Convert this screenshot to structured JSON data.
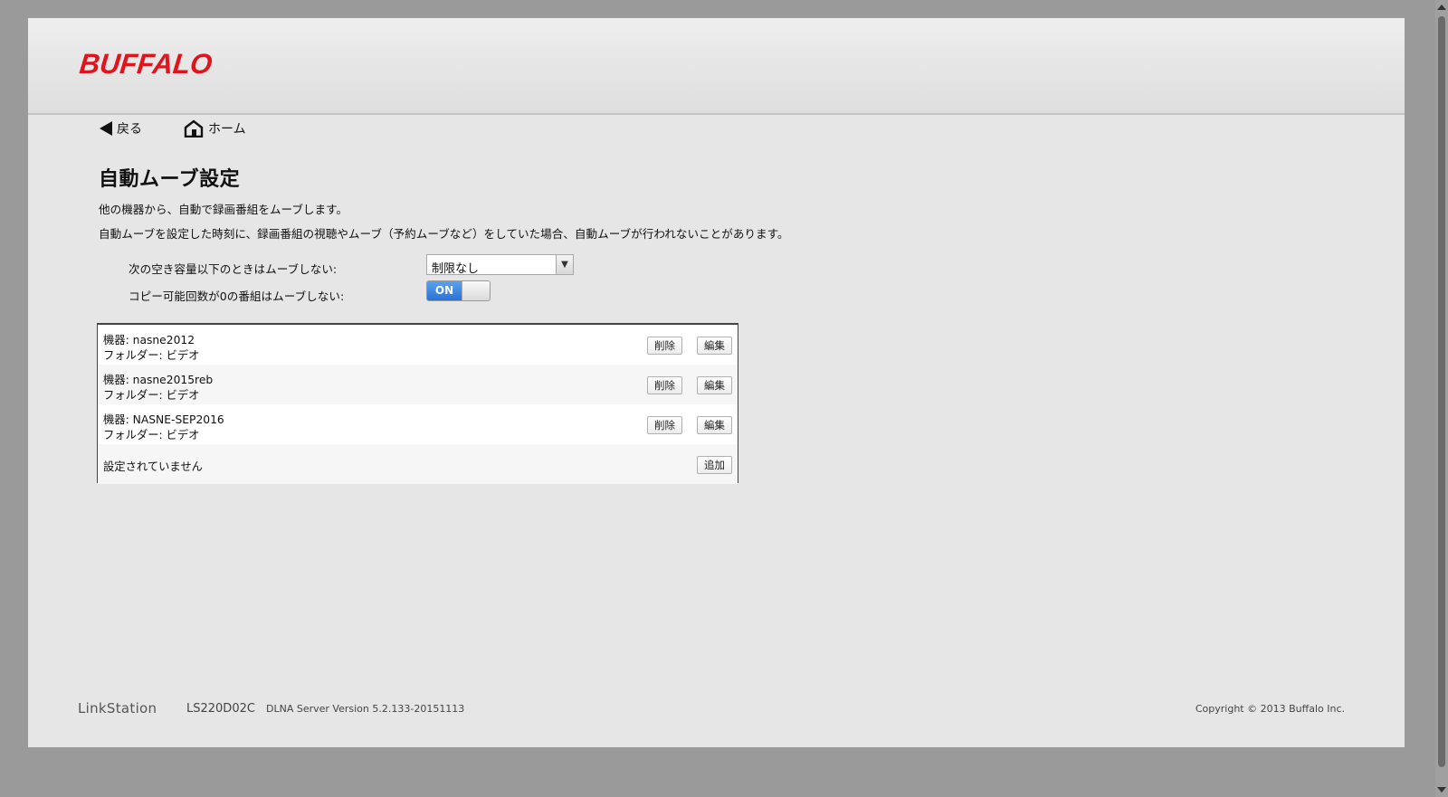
{
  "header": {
    "logo": "BUFFALO"
  },
  "nav": {
    "back_label": "戻る",
    "home_label": "ホーム"
  },
  "main": {
    "title": "自動ムーブ設定",
    "desc1": "他の機器から、自動で録画番組をムーブします。",
    "desc2": "自動ムーブを設定した時刻に、録画番組の視聴やムーブ（予約ムーブなど）をしていた場合、自動ムーブが行われないことがあります。"
  },
  "settings": {
    "capacity_label": "次の空き容量以下のときはムーブしない:",
    "capacity_value": "制限なし",
    "copy_label": "コピー可能回数が0の番組はムーブしない:",
    "copy_toggle": "ON"
  },
  "table": {
    "rows": [
      {
        "device": "機器: nasne2012",
        "folder": "フォルダー: ビデオ",
        "delete": "削除",
        "edit": "編集"
      },
      {
        "device": "機器: nasne2015reb",
        "folder": "フォルダー: ビデオ",
        "delete": "削除",
        "edit": "編集"
      },
      {
        "device": "機器: NASNE-SEP2016",
        "folder": "フォルダー: ビデオ",
        "delete": "削除",
        "edit": "編集"
      }
    ],
    "empty_text": "設定されていません",
    "add_label": "追加"
  },
  "footer": {
    "brand": "LinkStation",
    "model": "LS220D02C",
    "version": "DLNA Server Version 5.2.133-20151113",
    "copyright": "Copyright © 2013 Buffalo Inc."
  },
  "colors": {
    "logo_red": "#e0141c",
    "toggle_blue": "#2a72d6"
  }
}
